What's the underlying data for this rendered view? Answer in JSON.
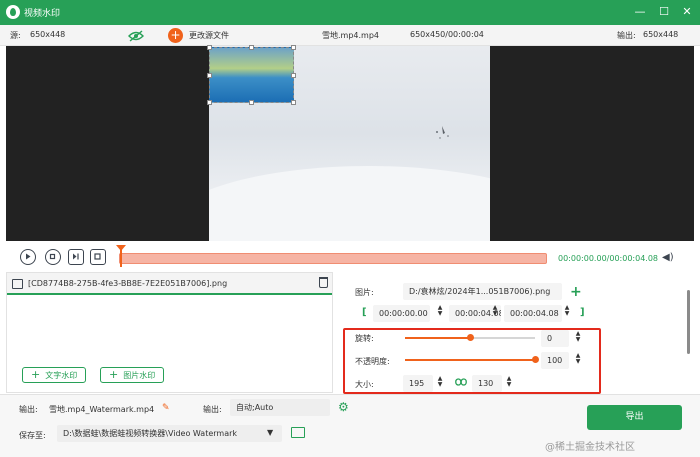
{
  "app": {
    "title": "视频水印",
    "accent": "#27a057",
    "orange": "#f0621b"
  },
  "infobar": {
    "source_label": "源:",
    "source_size": "650x448",
    "change_file": "更改源文件",
    "filename": "雪地.mp4.mp4",
    "size_duration": "650x450/00:00:04",
    "output_label": "输出:",
    "output_size": "650x448"
  },
  "playback": {
    "timecode": "00:00:00.00/00:00:04.08",
    "progress": 0.0
  },
  "watermark_list": {
    "items": [
      {
        "name": "[CD8774B8-275B-4fe3-BB8E-7E2E051B7006].png"
      }
    ],
    "add_text_label": "文字水印",
    "add_image_label": "图片水印"
  },
  "props": {
    "image_label": "图片:",
    "image_path": "D:/袁林炫/2024年1...051B7006).png",
    "start_time": "00:00:00.00",
    "end_time": "00:00:04.08",
    "duration": "00:00:04.08",
    "rotate_label": "旋转:",
    "rotate_value": "0",
    "rotate_level": 0.5,
    "opacity_label": "不透明度:",
    "opacity_value": "100",
    "opacity_level": 1.0,
    "size_label": "大小:",
    "width": "195",
    "height": "130"
  },
  "bottom": {
    "output_label": "输出:",
    "output_name": "雪地.mp4_Watermark.mp4",
    "format_label": "输出:",
    "format_value": "自动;Auto",
    "save_label": "保存至:",
    "save_path": "D:\\数据蛙\\数据蛙视频转换器\\Video Watermark",
    "export_label": "导出"
  },
  "credit": "@稀土掘金技术社区"
}
